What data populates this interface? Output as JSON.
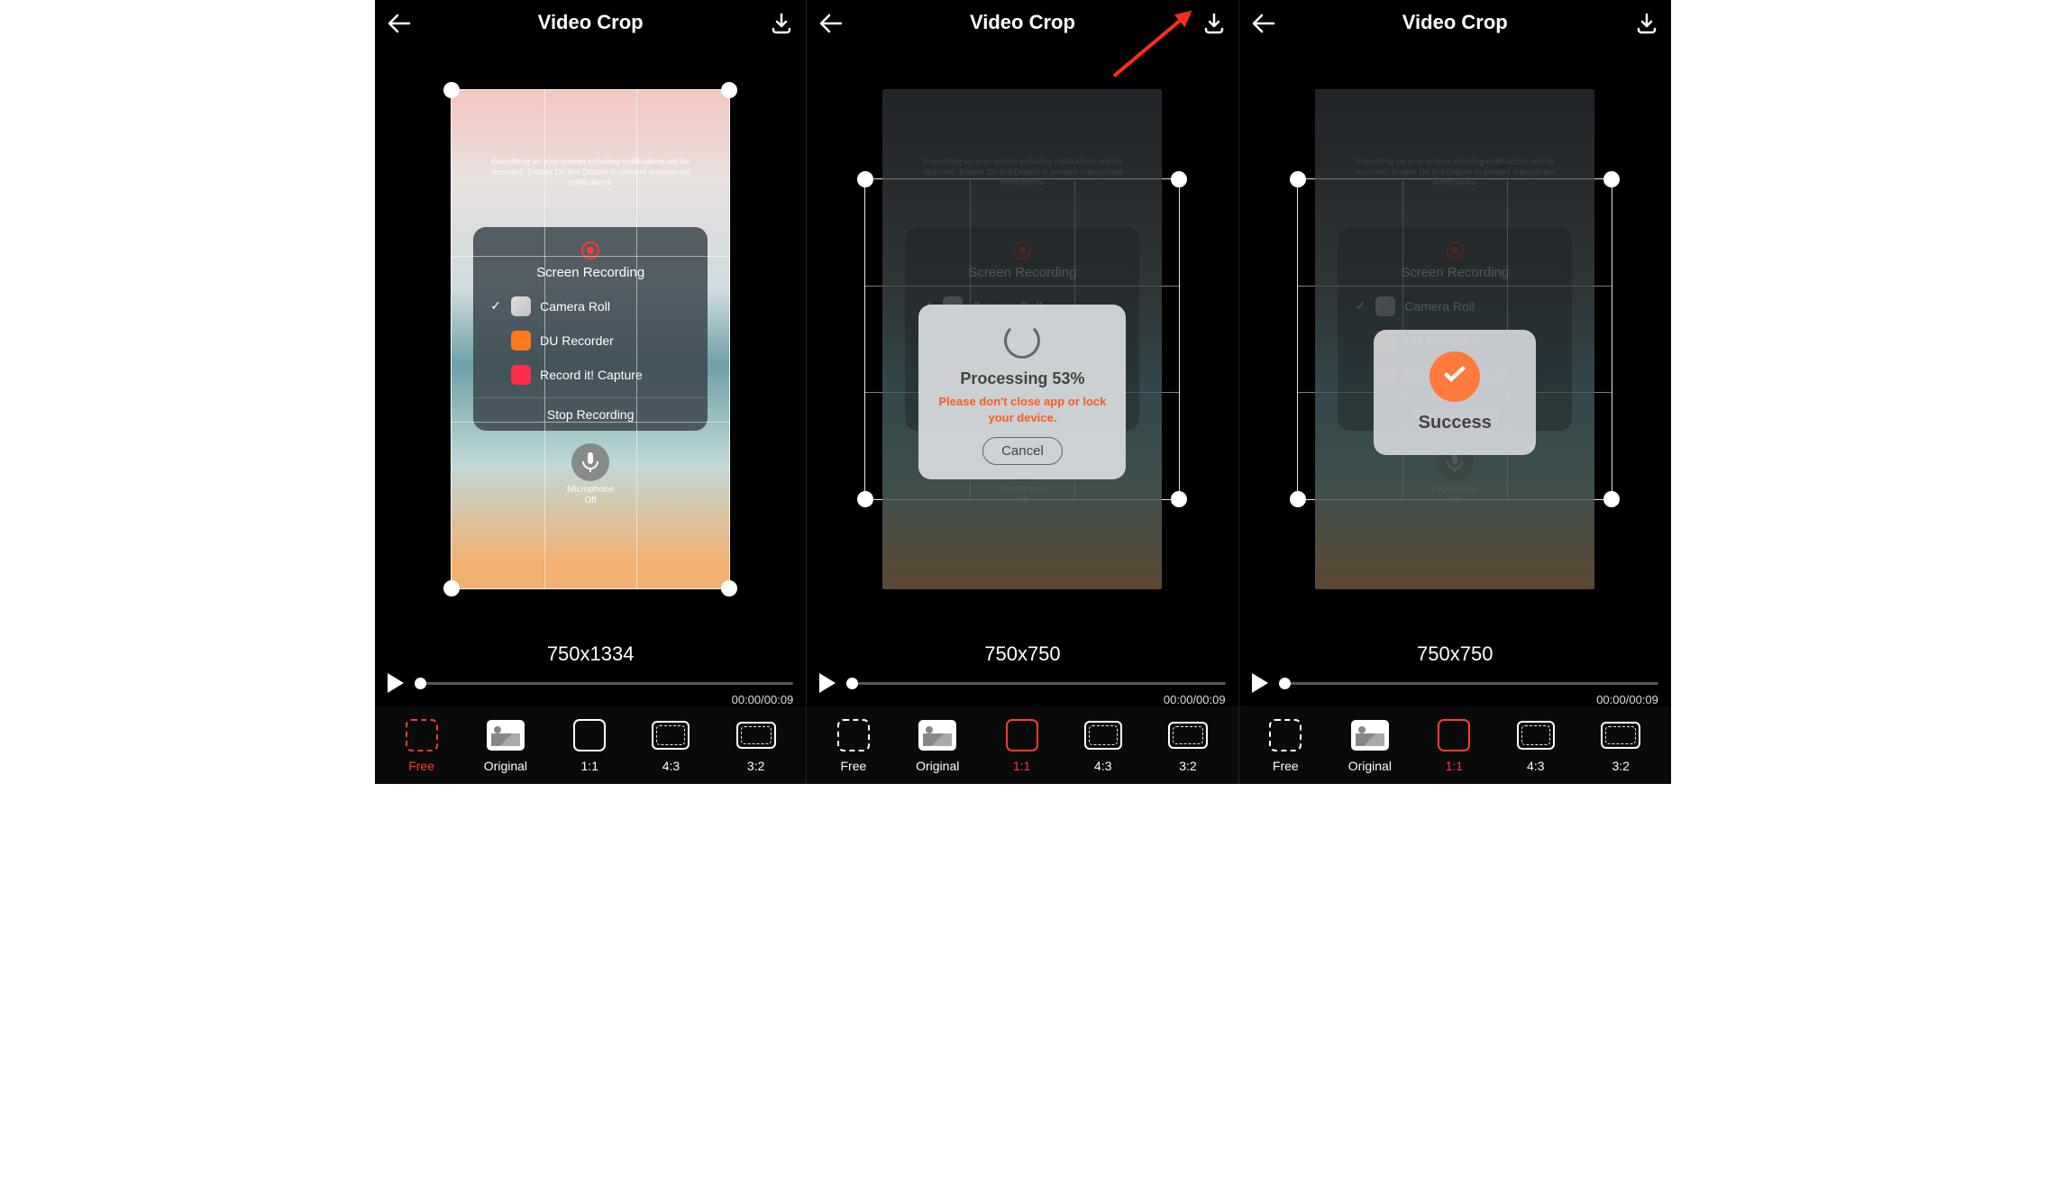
{
  "screens": [
    {
      "title": "Video Crop",
      "dimensions": "750x1334",
      "time_current": "00:00",
      "time_total": "00:09",
      "active_ratio": "free",
      "crop_mode": "full",
      "dimmed": false,
      "show_arrow": false,
      "modal": null
    },
    {
      "title": "Video Crop",
      "dimensions": "750x750",
      "time_current": "00:00",
      "time_total": "00:09",
      "active_ratio": "11",
      "crop_mode": "square",
      "dimmed": true,
      "show_arrow": true,
      "modal": "processing"
    },
    {
      "title": "Video Crop",
      "dimensions": "750x750",
      "time_current": "00:00",
      "time_total": "00:09",
      "active_ratio": "11",
      "crop_mode": "square",
      "dimmed": true,
      "show_arrow": false,
      "modal": "success"
    }
  ],
  "screen_recording": {
    "title": "Screen Recording",
    "items": [
      {
        "label": "Camera Roll",
        "checked": true,
        "icon": "camroll"
      },
      {
        "label": "DU Recorder",
        "checked": false,
        "icon": "du"
      },
      {
        "label": "Record it! Capture",
        "checked": false,
        "icon": "recordit"
      }
    ],
    "stop_label": "Stop Recording",
    "mic_label": "Microphone",
    "mic_state": "Off"
  },
  "ratios": [
    {
      "key": "free",
      "label": "Free"
    },
    {
      "key": "orig",
      "label": "Original"
    },
    {
      "key": "11",
      "label": "1:1"
    },
    {
      "key": "43",
      "label": "4:3"
    },
    {
      "key": "32",
      "label": "3:2"
    }
  ],
  "processing": {
    "title_prefix": "Processing ",
    "percent": "53%",
    "warning": "Please don't close app or lock your device.",
    "cancel": "Cancel"
  },
  "success": {
    "label": "Success"
  },
  "colors": {
    "accent": "#ff3b30",
    "warning": "#ff5a1f",
    "success": "#ff7a3d"
  }
}
